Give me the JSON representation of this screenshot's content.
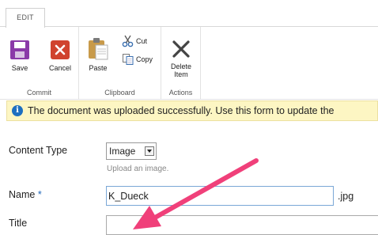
{
  "ribbon": {
    "tabs": [
      {
        "label": "EDIT"
      }
    ],
    "groups": [
      {
        "label": "Commit",
        "buttons": [
          {
            "label": "Save"
          },
          {
            "label": "Cancel"
          }
        ]
      },
      {
        "label": "Clipboard",
        "buttons": [
          {
            "label": "Paste"
          },
          {
            "label": "Cut"
          },
          {
            "label": "Copy"
          }
        ]
      },
      {
        "label": "Actions",
        "buttons": [
          {
            "label_line1": "Delete",
            "label_line2": "Item"
          }
        ]
      }
    ]
  },
  "status": {
    "message": "The document was uploaded successfully. Use this form to update the",
    "icon": "info-icon"
  },
  "form": {
    "content_type": {
      "label": "Content Type",
      "value": "Image",
      "hint": "Upload an image."
    },
    "name": {
      "label": "Name",
      "required_marker": "*",
      "value": "K_Dueck",
      "extension": ".jpg"
    },
    "title": {
      "label": "Title",
      "value": ""
    }
  },
  "colors": {
    "save_icon": "#8a3aa8",
    "cancel_icon": "#d0432e",
    "status_bg": "#fdf6c3",
    "info_icon": "#1d6fc0",
    "required_marker": "#1f66b8",
    "annotation_arrow": "#f0407a"
  }
}
